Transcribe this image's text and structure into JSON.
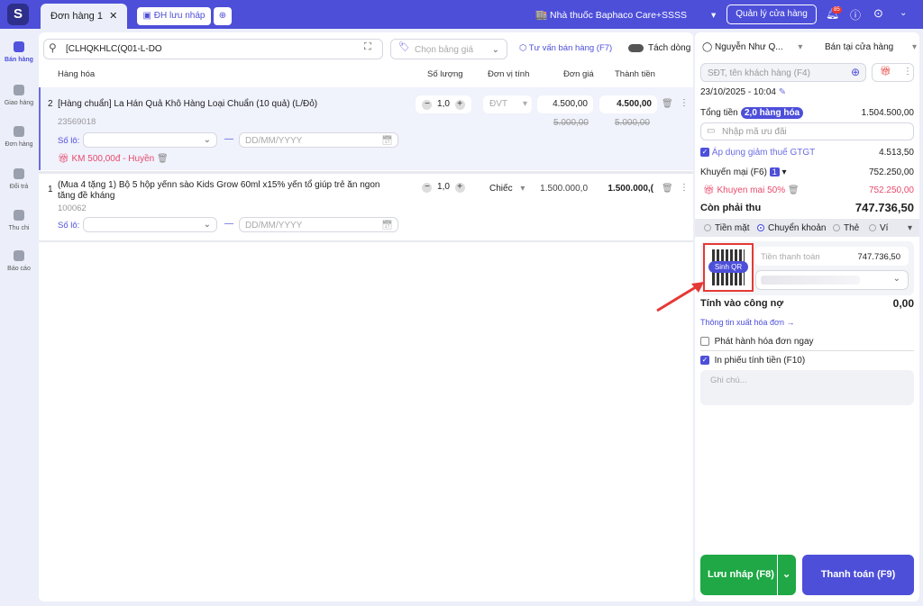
{
  "topbar": {
    "tab_label": "Đơn hàng",
    "tab_count": "1",
    "draft_button": "ĐH lưu nháp",
    "store_name": "Nhà thuốc Baphaco Care+SSSS",
    "store_manage": "Quản lý cửa hàng",
    "notif_count": "85"
  },
  "sidebar": {
    "items": [
      {
        "label": "Bán hàng"
      },
      {
        "label": "Giao hàng"
      },
      {
        "label": "Đơn hàng"
      },
      {
        "label": "Đổi trả"
      },
      {
        "label": "Thu chi"
      },
      {
        "label": "Báo cáo"
      }
    ]
  },
  "search": {
    "value": "[CLHQKHLC(Q01-L-DO",
    "price_placeholder": "Chọn bảng giá",
    "consult": "Tư vấn bán hàng (F7)",
    "split_line": "Tách dòng"
  },
  "table": {
    "headers": [
      "Hàng hóa",
      "Số lượng",
      "Đơn vị tính",
      "Đơn giá",
      "Thành tiền"
    ],
    "rows": [
      {
        "index": "2",
        "name": "[Hàng chuẩn] La Hán Quả Khô Hàng Loại Chuẩn (10 quả) (L/Đỏ)",
        "code": "23569018",
        "qty": "1,0",
        "unit": "ĐVT",
        "price": "4.500,00",
        "total": "4.500,00",
        "old_price": "5.000,00",
        "old_total": "5.000,00",
        "lot_label": "Số lô:",
        "date_placeholder": "DD/MM/YYYY",
        "promo": "KM 500,00đ - Huyền"
      },
      {
        "index": "1",
        "name": "(Mua 4 tặng 1) Bộ 5 hộp yếnn sào Kids Grow 60ml x15% yến tổ giúp trẻ ăn ngon tăng đề kháng",
        "code": "100062",
        "qty": "1,0",
        "unit": "Chiếc",
        "price": "1.500.000,0",
        "total": "1.500.000,(",
        "lot_label": "Số lô:",
        "date_placeholder": "DD/MM/YYYY"
      }
    ]
  },
  "right": {
    "seller": "Nguyễn Như Q...",
    "channel": "Bán tại cửa hàng",
    "customer_placeholder": "SĐT, tên khách hàng (F4)",
    "datetime": "23/10/2025 - 10:04",
    "total_label": "Tổng tiền",
    "total_badge": "2,0 hàng hóa",
    "total_value": "1.504.500,00",
    "coupon_placeholder": "Nhập mã ưu đãi",
    "vat_label": "Áp dụng giảm thuế GTGT",
    "vat_value": "4.513,50",
    "promo_label": "Khuyến mại (F6)",
    "promo_count": "1",
    "promo_value": "752.250,00",
    "promo_item": "Khuyen mai 50%",
    "promo_item_value": "752.250,00",
    "due_label": "Còn phải thu",
    "due_value": "747.736,50",
    "payment_methods": [
      "Tiền mặt",
      "Chuyển khoản",
      "Thẻ",
      "Ví"
    ],
    "qr_label": "Sinh QR",
    "pay_amount_label": "Tiền thanh toán",
    "pay_amount": "747.736,50",
    "debt_label": "Tính vào công nợ",
    "debt_value": "0,00",
    "invoice_link": "Thông tin xuất hóa đơn →",
    "issue_invoice": "Phát hành hóa đơn ngay",
    "print_receipt": "In phiếu tính tiền (F10)",
    "note_placeholder": "Ghi chú...",
    "save_draft": "Lưu nháp (F8)",
    "pay": "Thanh toán (F9)"
  },
  "colors": {
    "primary": "#4d4fd9",
    "green": "#1fa845",
    "red": "#e53935"
  }
}
